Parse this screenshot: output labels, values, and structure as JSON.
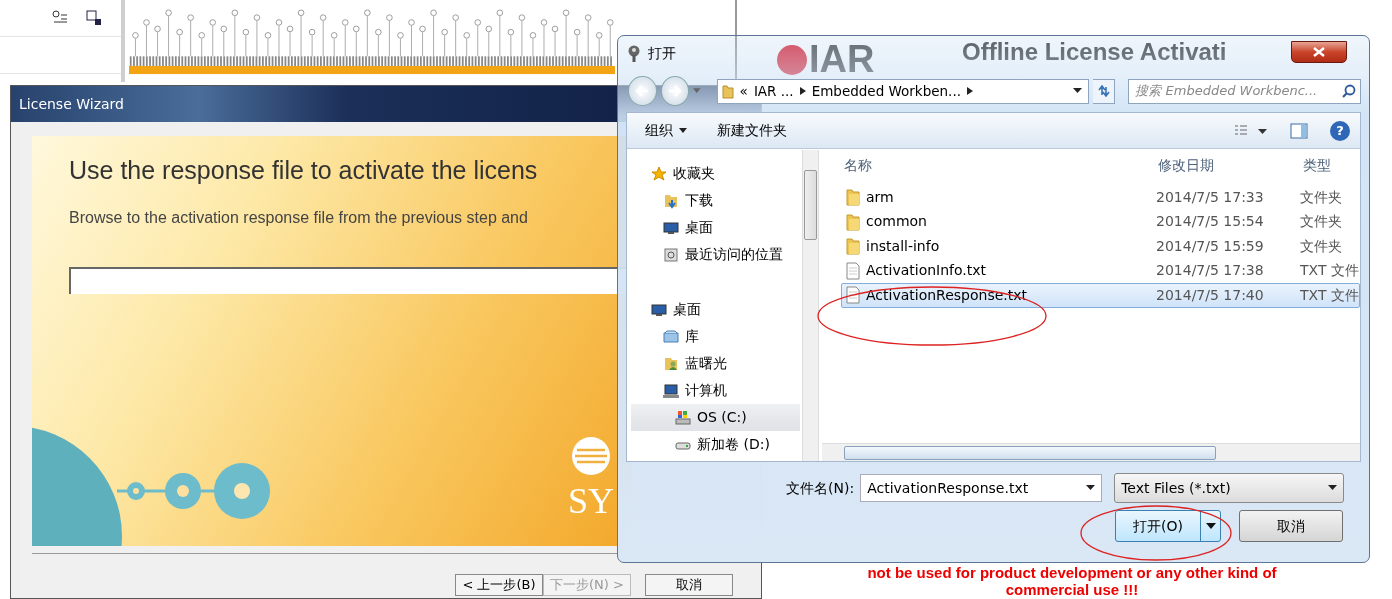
{
  "browser_page": {
    "logo": "IAR",
    "heading": "Offline License Activati",
    "warning_lines": [
      "not be used for product development or any other kind of",
      "commercial use !!!"
    ]
  },
  "license_wizard": {
    "title": "License Wizard",
    "heading": "Use the response file to activate the licens",
    "description": "Browse to the activation response file from the previous step and",
    "logo_text": "SY",
    "buttons": [
      {
        "label": "< 上一步(B)",
        "disabled": false
      },
      {
        "label": "下一步(N) >",
        "disabled": true
      },
      {
        "label": "取消",
        "disabled": false
      }
    ]
  },
  "open_dialog": {
    "title": "打开",
    "breadcrumb": {
      "overflow": "«",
      "parts": [
        "IAR ...",
        "Embedded Workben..."
      ]
    },
    "search": {
      "placeholder": "搜索 Embedded Workbenc..."
    },
    "toolbar": [
      {
        "label": "组织",
        "dropdown": true
      },
      {
        "label": "新建文件夹",
        "dropdown": false
      }
    ],
    "nav_tree": [
      {
        "label": "收藏夹",
        "kind": "star",
        "selected": false,
        "children": [
          {
            "label": "下载",
            "kind": "download",
            "selected": false
          },
          {
            "label": "桌面",
            "kind": "desktop",
            "selected": false
          },
          {
            "label": "最近访问的位置",
            "kind": "recent",
            "selected": false
          }
        ]
      },
      {
        "label": "桌面",
        "kind": "desktop",
        "selected": false,
        "children": [
          {
            "label": "库",
            "kind": "library",
            "selected": false
          },
          {
            "label": "蓝曙光",
            "kind": "user",
            "selected": false
          },
          {
            "label": "计算机",
            "kind": "computer",
            "selected": false,
            "children": [
              {
                "label": "OS (C:)",
                "kind": "osdrive",
                "selected": true
              },
              {
                "label": "新加卷 (D:)",
                "kind": "drive",
                "selected": false
              }
            ]
          }
        ]
      }
    ],
    "columns": [
      "名称",
      "修改日期",
      "类型"
    ],
    "files": [
      {
        "name": "arm",
        "date": "2014/7/5 17:33",
        "type": "文件夹",
        "kind": "folder",
        "selected": false,
        "circled": false
      },
      {
        "name": "common",
        "date": "2014/7/5 15:54",
        "type": "文件夹",
        "kind": "folder",
        "selected": false,
        "circled": false
      },
      {
        "name": "install-info",
        "date": "2014/7/5 15:59",
        "type": "文件夹",
        "kind": "folder",
        "selected": false,
        "circled": false
      },
      {
        "name": "ActivationInfo.txt",
        "date": "2014/7/5 17:38",
        "type": "TXT 文件",
        "kind": "text",
        "selected": false,
        "circled": false
      },
      {
        "name": "ActivationResponse.txt",
        "date": "2014/7/5 17:40",
        "type": "TXT 文件",
        "kind": "text",
        "selected": true,
        "circled": true
      }
    ],
    "filename_label": "文件名(N):",
    "filename_value": "ActivationResponse.txt",
    "file_type": "Text Files (*.txt)",
    "help_glyph": "?",
    "open_button": {
      "label": "打开(O)",
      "circled": true
    },
    "cancel_button": {
      "label": "取消"
    }
  }
}
